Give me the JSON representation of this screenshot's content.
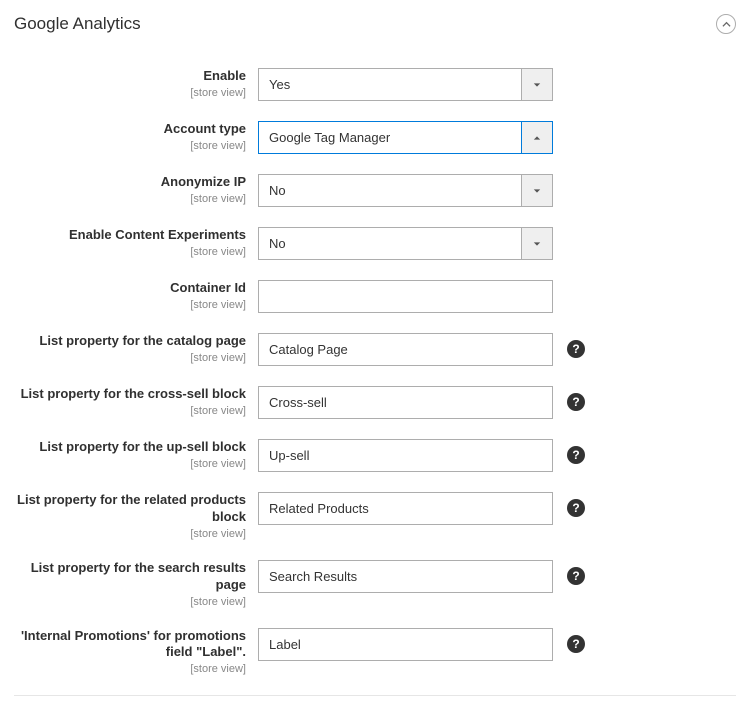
{
  "section": {
    "title": "Google Analytics"
  },
  "scope_label": "[store view]",
  "fields": [
    {
      "id": "enable",
      "label": "Enable",
      "type": "select",
      "value": "Yes",
      "open": false,
      "help": false
    },
    {
      "id": "account_type",
      "label": "Account type",
      "type": "select",
      "value": "Google Tag Manager",
      "open": true,
      "help": false
    },
    {
      "id": "anonymize_ip",
      "label": "Anonymize IP",
      "type": "select",
      "value": "No",
      "open": false,
      "help": false
    },
    {
      "id": "content_exp",
      "label": "Enable Content Experiments",
      "type": "select",
      "value": "No",
      "open": false,
      "help": false
    },
    {
      "id": "container_id",
      "label": "Container Id",
      "type": "text",
      "value": "",
      "help": false
    },
    {
      "id": "list_catalog",
      "label": "List property for the catalog page",
      "type": "text",
      "value": "Catalog Page",
      "help": true
    },
    {
      "id": "list_crosssell",
      "label": "List property for the cross-sell block",
      "type": "text",
      "value": "Cross-sell",
      "help": true
    },
    {
      "id": "list_upsell",
      "label": "List property for the up-sell block",
      "type": "text",
      "value": "Up-sell",
      "help": true
    },
    {
      "id": "list_related",
      "label": "List property for the related products block",
      "type": "text",
      "value": "Related Products",
      "help": true
    },
    {
      "id": "list_search",
      "label": "List property for the search results page",
      "type": "text",
      "value": "Search Results",
      "help": true
    },
    {
      "id": "promo_label",
      "label": "'Internal Promotions' for promotions field \"Label\".",
      "type": "text",
      "value": "Label",
      "help": true
    }
  ]
}
